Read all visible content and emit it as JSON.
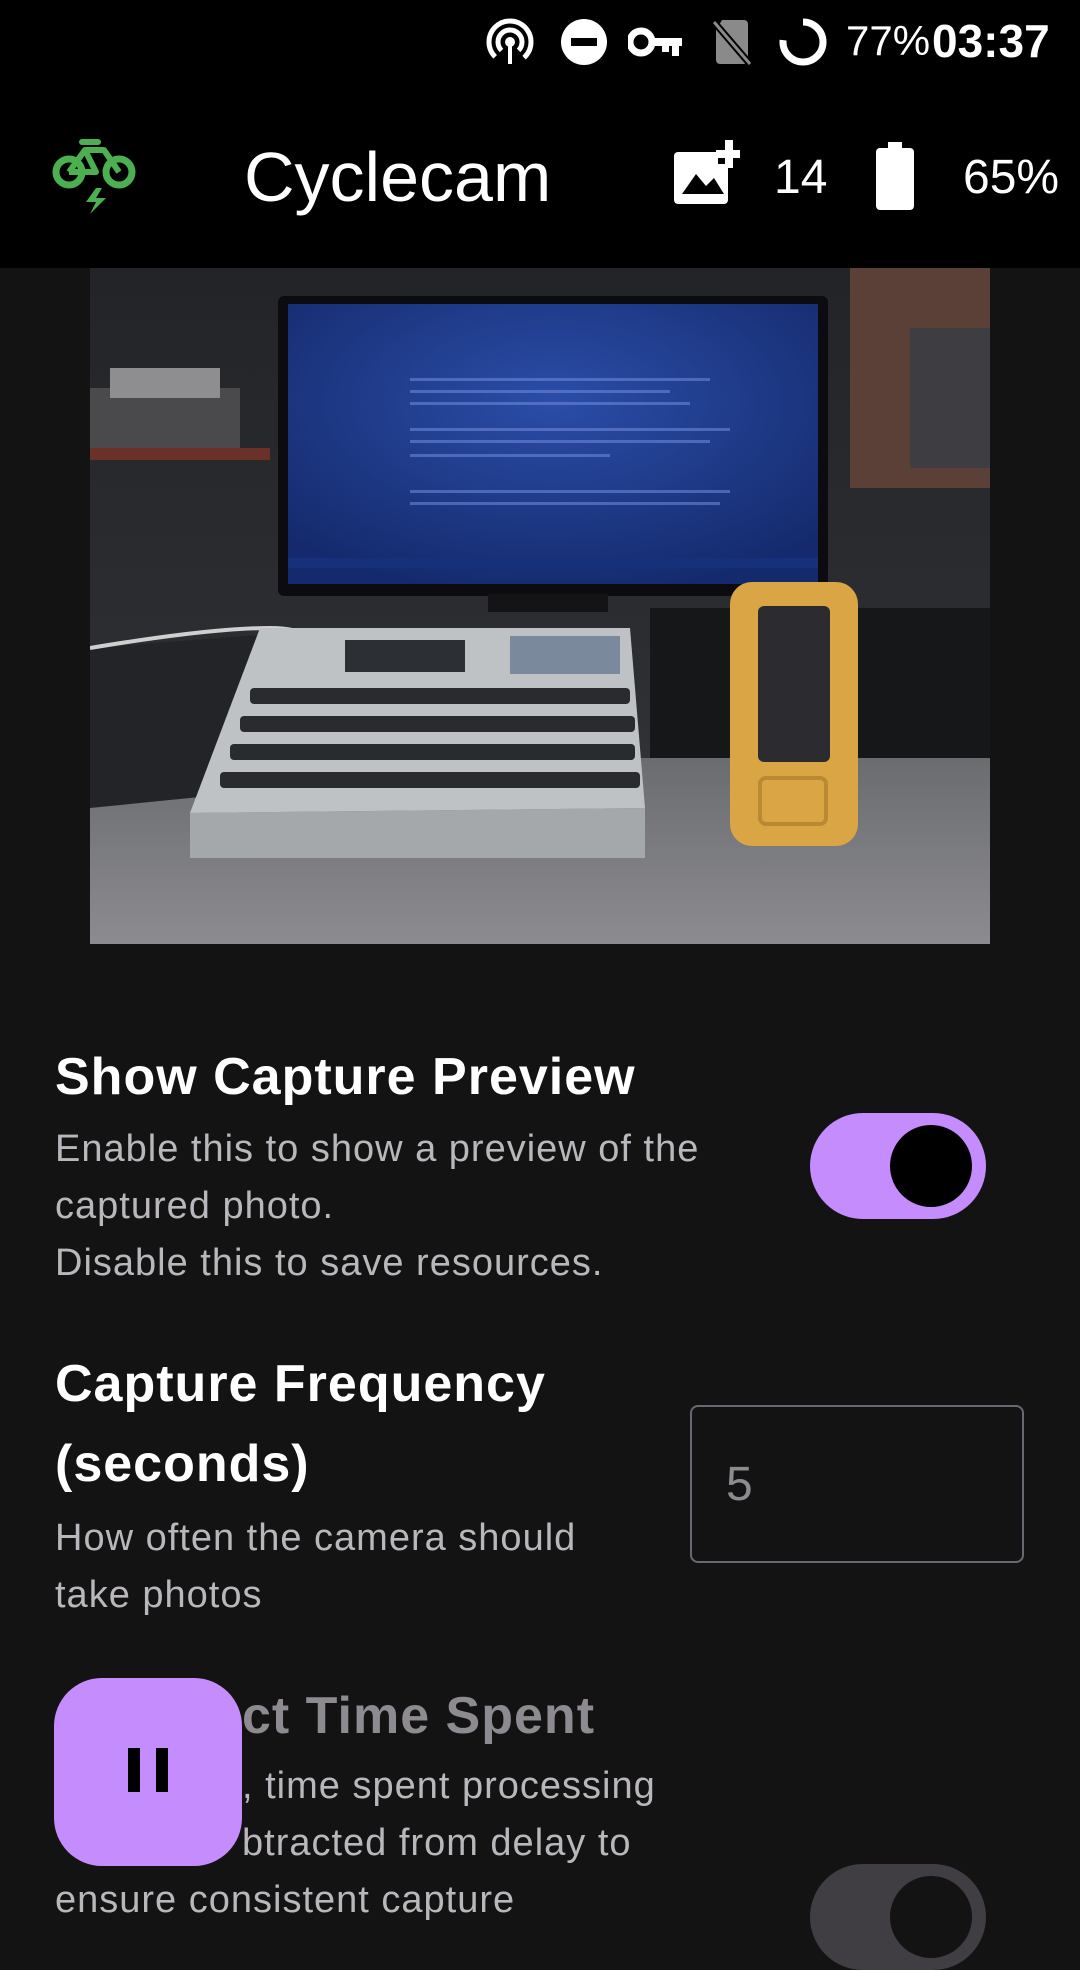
{
  "status_bar": {
    "battery_percent": "77%",
    "clock": "03:37",
    "icons": [
      "hotspot-icon",
      "do-not-disturb-icon",
      "vpn-key-icon",
      "no-sim-icon",
      "battery-ring-icon"
    ]
  },
  "app_bar": {
    "logo_icon": "electric-bike-icon",
    "title": "Cyclecam",
    "photo_count_icon": "add-photo-icon",
    "photo_count": "14",
    "device_battery_icon": "battery-icon",
    "device_battery": "65%",
    "logo_color": "#4caf50"
  },
  "preview": {
    "icon": "capture-preview-image"
  },
  "settings": {
    "show_capture_preview": {
      "title": "Show Capture Preview",
      "desc_line1": "Enable this to show a preview of the",
      "desc_line2": "captured photo.",
      "desc_line3": "Disable this to save resources.",
      "enabled": true
    },
    "capture_frequency": {
      "title_line1": "Capture Frequency",
      "title_line2": "(seconds)",
      "desc_line1": "How often the camera should",
      "desc_line2": "take photos",
      "value": "5"
    },
    "subtract_time": {
      "title_partial": "ct Time Spent",
      "desc_line1": ", time spent processing",
      "desc_line2": "btracted from delay to",
      "desc_line3": "ensure consistent capture",
      "enabled": false
    }
  },
  "fab": {
    "icon": "pause-icon"
  },
  "colors": {
    "accent": "#c48cfc",
    "background": "#141314",
    "bar": "#000000"
  }
}
